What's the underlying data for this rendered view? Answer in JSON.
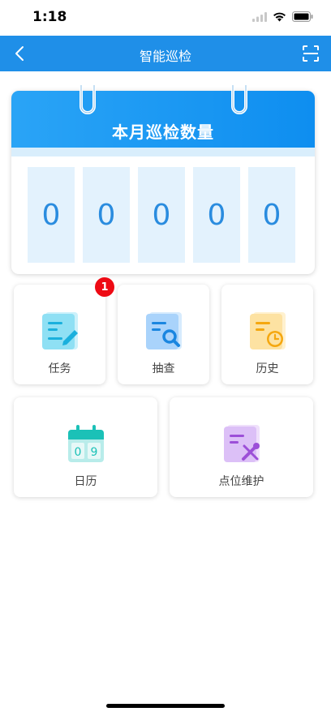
{
  "status_bar": {
    "time": "1:18"
  },
  "nav": {
    "title": "智能巡检"
  },
  "counter": {
    "title": "本月巡检数量",
    "digits": [
      "0",
      "0",
      "0",
      "0",
      "0"
    ]
  },
  "tiles": {
    "task": {
      "label": "任务",
      "badge": "1"
    },
    "spot_check": {
      "label": "抽查"
    },
    "history": {
      "label": "历史"
    },
    "calendar": {
      "label": "日历",
      "icon_digits": [
        "0",
        "9"
      ]
    },
    "point_maintenance": {
      "label": "点位维护"
    }
  },
  "colors": {
    "primary": "#1f8fe8",
    "badge": "#ee0a14",
    "digit_bg": "#e3f2fd",
    "digit_text": "#2a8cdf"
  },
  "icons": {
    "task": "document-edit-icon",
    "spot_check": "document-search-icon",
    "history": "document-clock-icon",
    "calendar": "calendar-icon",
    "point_maintenance": "document-tools-icon"
  }
}
